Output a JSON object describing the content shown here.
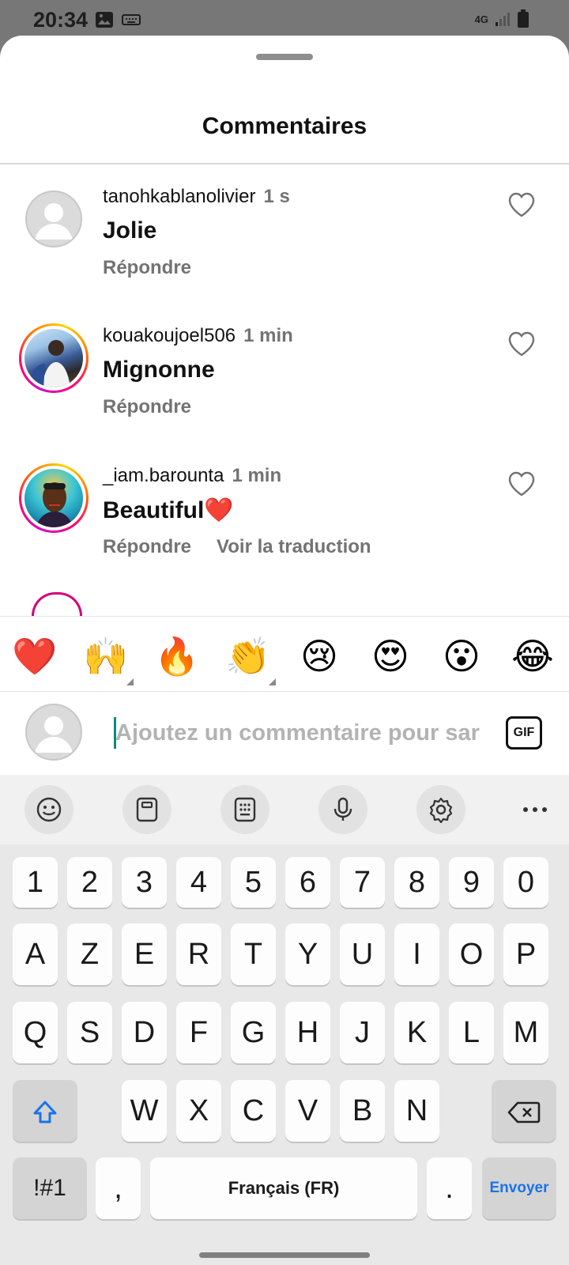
{
  "status": {
    "time": "20:34",
    "network": "4G"
  },
  "sheet": {
    "title": "Commentaires"
  },
  "comments": [
    {
      "user": "tanohkablanolivier",
      "time": "1 s",
      "text": "Jolie",
      "reply": "Répondre",
      "translate": ""
    },
    {
      "user": "kouakoujoel506",
      "time": "1 min",
      "text": "Mignonne",
      "reply": "Répondre",
      "translate": ""
    },
    {
      "user": "_iam.barounta",
      "time": "1 min",
      "text": "Beautiful❤️",
      "reply": "Répondre",
      "translate": "Voir la traduction"
    }
  ],
  "emoji_bar": [
    "❤️",
    "🙌",
    "🔥",
    "👏",
    "😢",
    "😍",
    "😮",
    "😂"
  ],
  "composer": {
    "placeholder": "Ajoutez un commentaire pour sar",
    "value": "",
    "gif_label": "GIF"
  },
  "keyboard": {
    "toolbar": [
      "emoji-icon",
      "clipboard-icon",
      "keypad-icon",
      "microphone-icon",
      "settings-icon",
      "more-icon"
    ],
    "number_row": [
      "1",
      "2",
      "3",
      "4",
      "5",
      "6",
      "7",
      "8",
      "9",
      "0"
    ],
    "row1": [
      "A",
      "Z",
      "E",
      "R",
      "T",
      "Y",
      "U",
      "I",
      "O",
      "P"
    ],
    "row2": [
      "Q",
      "S",
      "D",
      "F",
      "G",
      "H",
      "J",
      "K",
      "L",
      "M"
    ],
    "row3": [
      "W",
      "X",
      "C",
      "V",
      "B",
      "N"
    ],
    "symbols_label": "!#1",
    "comma_label": ",",
    "space_label": "Français (FR)",
    "period_label": ".",
    "enter_label": "Envoyer"
  },
  "colors": {
    "accent_blue": "#1a73e8",
    "heart_red": "#e0142c",
    "caret": "#0b8a7a"
  }
}
